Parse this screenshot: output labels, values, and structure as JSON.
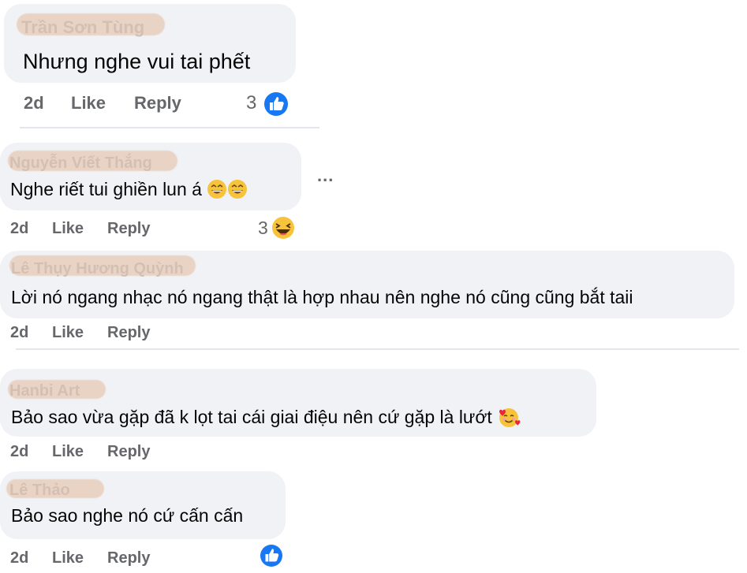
{
  "comments": [
    {
      "author": "Trần Sơn Tùng",
      "text": "Nhưng nghe vui tai phết",
      "time": "2d",
      "like_label": "Like",
      "reply_label": "Reply",
      "reaction_count": "3",
      "reaction_icon": "like-icon"
    },
    {
      "author": "Nguyễn Viết Thắng",
      "text": "Nghe riết tui ghiền lun á",
      "emojis": [
        "grinning-squinting-face-icon",
        "grinning-squinting-face-icon"
      ],
      "time": "2d",
      "like_label": "Like",
      "reply_label": "Reply",
      "reaction_count": "3",
      "reaction_icon": "haha-icon",
      "menu": "..."
    },
    {
      "author": "Lê Thụy Hương Quỳnh",
      "text": "Lời nó ngang nhạc nó ngang thật là hợp nhau nên nghe nó cũng cũng bắt taii",
      "time": "2d",
      "like_label": "Like",
      "reply_label": "Reply"
    },
    {
      "author": "Hanbi Art",
      "text": "Bảo sao vừa gặp đã k lọt tai cái giai điệu nên cứ gặp là lướt",
      "emojis": [
        "smiling-face-with-hearts-icon"
      ],
      "time": "2d",
      "like_label": "Like",
      "reply_label": "Reply"
    },
    {
      "author": "Lê Thảo",
      "text": "Bảo sao nghe nó cứ cấn cấn",
      "time": "2d",
      "like_label": "Like",
      "reply_label": "Reply",
      "reaction_icon": "like-icon"
    }
  ],
  "colors": {
    "bubble": "#f0f2f5",
    "meta": "#65676b",
    "like_blue": "#1877f2",
    "emoji_yellow": "#f7c33b"
  }
}
